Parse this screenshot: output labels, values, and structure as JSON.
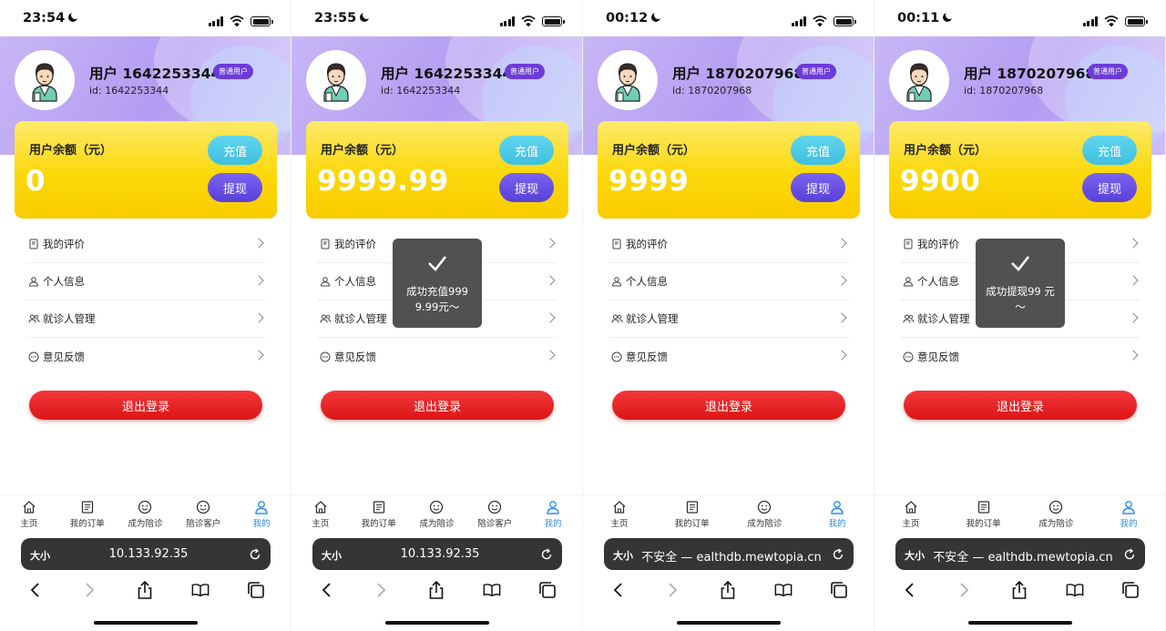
{
  "badge": "普通用户",
  "balance_label": "用户余额（元）",
  "recharge_label": "充值",
  "withdraw_label": "提现",
  "menu": [
    "我的评价",
    "个人信息",
    "就诊人管理",
    "意见反馈"
  ],
  "logout_label": "退出登录",
  "tabs": [
    "主页",
    "我的订单",
    "成为陪诊",
    "陪诊客户",
    "我的"
  ],
  "text_size_label": "大小",
  "colors": {
    "accent": "#6d3bd9",
    "card": "#fbd80a",
    "logout": "#e11d1d",
    "tab_active": "#2f8ee8"
  },
  "icons": {
    "menu": [
      "review-icon",
      "person-icon",
      "people-icon",
      "chat-icon"
    ],
    "tabs": [
      "home-icon",
      "order-icon",
      "smile-icon",
      "smile-icon",
      "user-icon"
    ],
    "browser": [
      "back-icon",
      "forward-icon",
      "share-icon",
      "bookmarks-icon",
      "tabs-icon"
    ]
  },
  "screens": [
    {
      "time": "23:54",
      "user": "用户 1642253344",
      "id": "id: 1642253344",
      "balance": "0",
      "url": "10.133.92.35",
      "tabs": [
        "主页",
        "我的订单",
        "成为陪诊",
        "陪诊客户",
        "我的"
      ],
      "toast": ""
    },
    {
      "time": "23:55",
      "user": "用户 1642253344",
      "id": "id: 1642253344",
      "balance": "9999.99",
      "url": "10.133.92.35",
      "tabs": [
        "主页",
        "我的订单",
        "成为陪诊",
        "陪诊客户",
        "我的"
      ],
      "toast": "成功充值999 9.99元～"
    },
    {
      "time": "00:12",
      "user": "用户 1870207968",
      "id": "id: 1870207968",
      "balance": "9999",
      "url": "不安全 — ealthdb.mewtopia.cn",
      "tabs": [
        "主页",
        "我的订单",
        "成为陪诊",
        "我的"
      ],
      "toast": ""
    },
    {
      "time": "00:11",
      "user": "用户 1870207968",
      "id": "id: 1870207968",
      "balance": "9900",
      "url": "不安全 — ealthdb.mewtopia.cn",
      "tabs": [
        "主页",
        "我的订单",
        "成为陪诊",
        "我的"
      ],
      "toast": "成功提现99 元～"
    }
  ]
}
